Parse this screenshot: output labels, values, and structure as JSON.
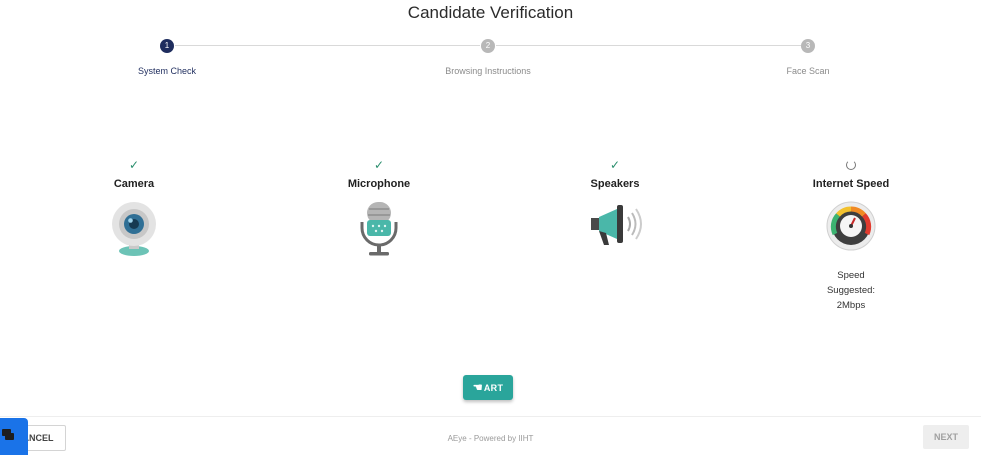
{
  "page": {
    "title": "Candidate Verification"
  },
  "stepper": {
    "steps": [
      {
        "number": "1",
        "label": "System Check",
        "active": true
      },
      {
        "number": "2",
        "label": "Browsing Instructions",
        "active": false
      },
      {
        "number": "3",
        "label": "Face Scan",
        "active": false
      }
    ]
  },
  "checks": [
    {
      "name": "Camera",
      "status": "ok",
      "status_glyph": "✓",
      "icon": "webcam-icon"
    },
    {
      "name": "Microphone",
      "status": "ok",
      "status_glyph": "✓",
      "icon": "microphone-icon"
    },
    {
      "name": "Speakers",
      "status": "ok",
      "status_glyph": "✓",
      "icon": "megaphone-icon"
    },
    {
      "name": "Internet Speed",
      "status": "loading",
      "icon": "speedometer-icon",
      "speed_label": "Speed",
      "suggested_label": "Suggested:",
      "suggested_value": "2Mbps"
    }
  ],
  "actions": {
    "start_label": "ART",
    "cancel_label": "ANCEL",
    "next_label": "NEXT"
  },
  "footer": {
    "powered_by": "AEye - Powered by IIHT"
  },
  "colors": {
    "accent_teal": "#2aa59b",
    "step_active": "#1f2d5e",
    "step_inactive": "#b8b8b8",
    "ok_green": "#2b8f6e",
    "chat_blue": "#1a73e8"
  }
}
